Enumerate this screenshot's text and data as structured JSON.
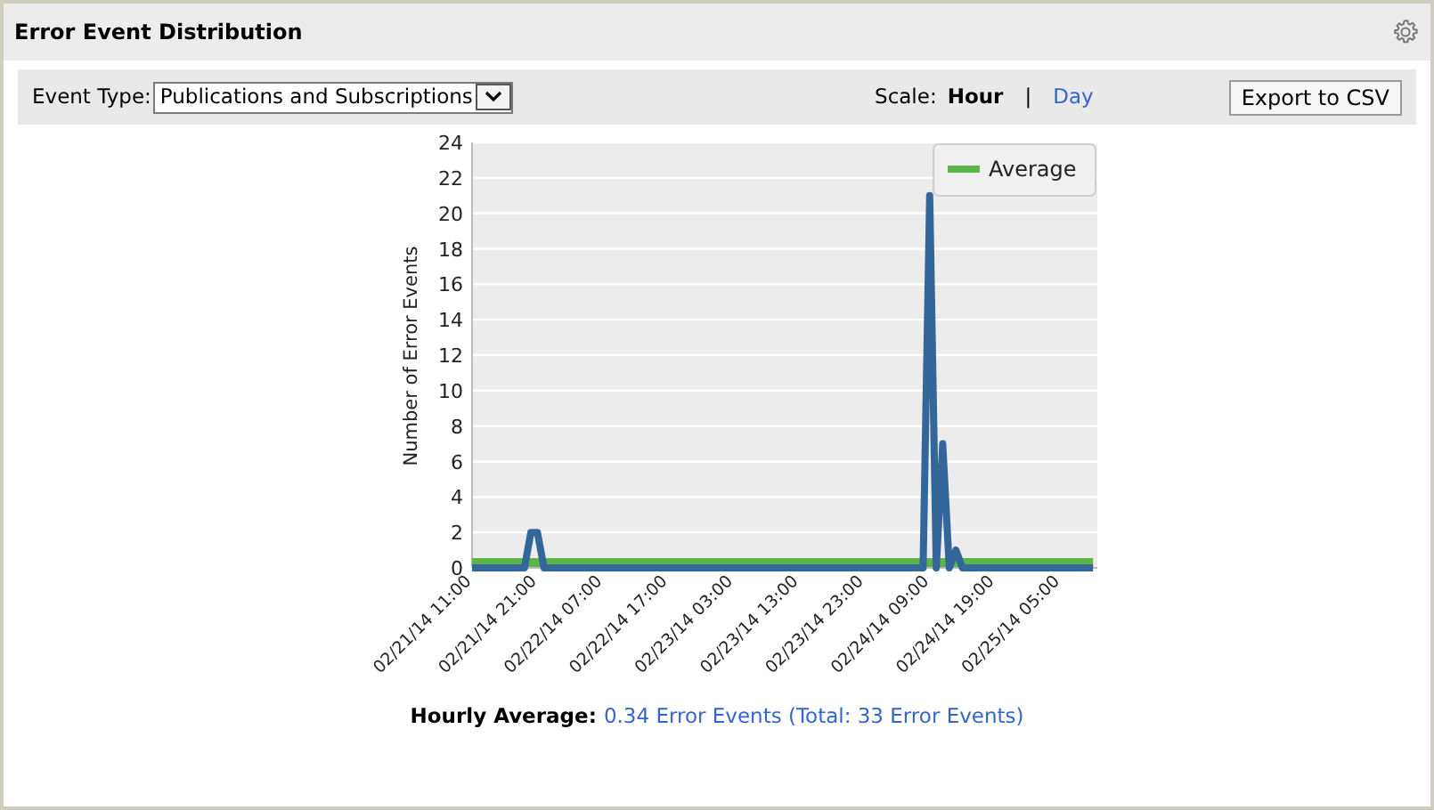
{
  "panel": {
    "title": "Error Event Distribution"
  },
  "toolbar": {
    "event_type_label": "Event Type:",
    "event_type_value": "Publications and Subscriptions",
    "scale_label": "Scale:",
    "scale_options": [
      {
        "label": "Hour",
        "selected": true
      },
      {
        "label": "Day",
        "selected": false
      }
    ],
    "separator": "|",
    "export_button": "Export to CSV"
  },
  "chart_data": {
    "type": "line",
    "ylabel": "Number of Error Events",
    "ylim": [
      0,
      24
    ],
    "grid": true,
    "yticks": [
      0,
      2,
      4,
      6,
      8,
      10,
      12,
      14,
      16,
      18,
      20,
      22,
      24
    ],
    "categories": [
      "02/21/14 11:00",
      null,
      null,
      null,
      null,
      null,
      null,
      null,
      null,
      null,
      "02/21/14 21:00",
      null,
      null,
      null,
      null,
      null,
      null,
      null,
      null,
      null,
      "02/22/14 07:00",
      null,
      null,
      null,
      null,
      null,
      null,
      null,
      null,
      null,
      "02/22/14 17:00",
      null,
      null,
      null,
      null,
      null,
      null,
      null,
      null,
      null,
      "02/23/14 03:00",
      null,
      null,
      null,
      null,
      null,
      null,
      null,
      null,
      null,
      "02/23/14 13:00",
      null,
      null,
      null,
      null,
      null,
      null,
      null,
      null,
      null,
      "02/23/14 23:00",
      null,
      null,
      null,
      null,
      null,
      null,
      null,
      null,
      null,
      "02/24/14 09:00",
      null,
      null,
      null,
      null,
      null,
      null,
      null,
      null,
      null,
      "02/24/14 19:00",
      null,
      null,
      null,
      null,
      null,
      null,
      null,
      null,
      null,
      "02/25/14 05:00",
      null,
      null,
      null,
      null,
      null
    ],
    "series": [
      {
        "name": "Average",
        "color": "#5cb547",
        "values": [
          0.3,
          0.3,
          0.3,
          0.3,
          0.3,
          0.3,
          0.3,
          0.3,
          0.3,
          0.3,
          0.3,
          0.3,
          0.3,
          0.3,
          0.3,
          0.3,
          0.3,
          0.3,
          0.3,
          0.3,
          0.3,
          0.3,
          0.3,
          0.3,
          0.3,
          0.3,
          0.3,
          0.3,
          0.3,
          0.3,
          0.3,
          0.3,
          0.3,
          0.3,
          0.3,
          0.3,
          0.3,
          0.3,
          0.3,
          0.3,
          0.3,
          0.3,
          0.3,
          0.3,
          0.3,
          0.3,
          0.3,
          0.3,
          0.3,
          0.3,
          0.3,
          0.3,
          0.3,
          0.3,
          0.3,
          0.3,
          0.3,
          0.3,
          0.3,
          0.3,
          0.3,
          0.3,
          0.3,
          0.3,
          0.3,
          0.3,
          0.3,
          0.3,
          0.3,
          0.3,
          0.3,
          0.3,
          0.3,
          0.3,
          0.3,
          0.3,
          0.3,
          0.3,
          0.3,
          0.3,
          0.3,
          0.3,
          0.3,
          0.3,
          0.3,
          0.3,
          0.3,
          0.3,
          0.3,
          0.3,
          0.3,
          0.3,
          0.3,
          0.3,
          0.3,
          0.3
        ]
      },
      {
        "color": "#336699",
        "values": [
          0,
          0,
          0,
          0,
          0,
          0,
          0,
          0,
          0,
          2,
          2,
          0,
          0,
          0,
          0,
          0,
          0,
          0,
          0,
          0,
          0,
          0,
          0,
          0,
          0,
          0,
          0,
          0,
          0,
          0,
          0,
          0,
          0,
          0,
          0,
          0,
          0,
          0,
          0,
          0,
          0,
          0,
          0,
          0,
          0,
          0,
          0,
          0,
          0,
          0,
          0,
          0,
          0,
          0,
          0,
          0,
          0,
          0,
          0,
          0,
          0,
          0,
          0,
          0,
          0,
          0,
          0,
          0,
          0,
          0,
          21,
          0,
          7,
          0,
          1,
          0,
          0,
          0,
          0,
          0,
          0,
          0,
          0,
          0,
          0,
          0,
          0,
          0,
          0,
          0,
          0,
          0,
          0,
          0,
          0,
          0
        ]
      }
    ]
  },
  "footer": {
    "label": "Hourly Average:",
    "value": "0.34 Error Events (Total: 33 Error Events)"
  }
}
